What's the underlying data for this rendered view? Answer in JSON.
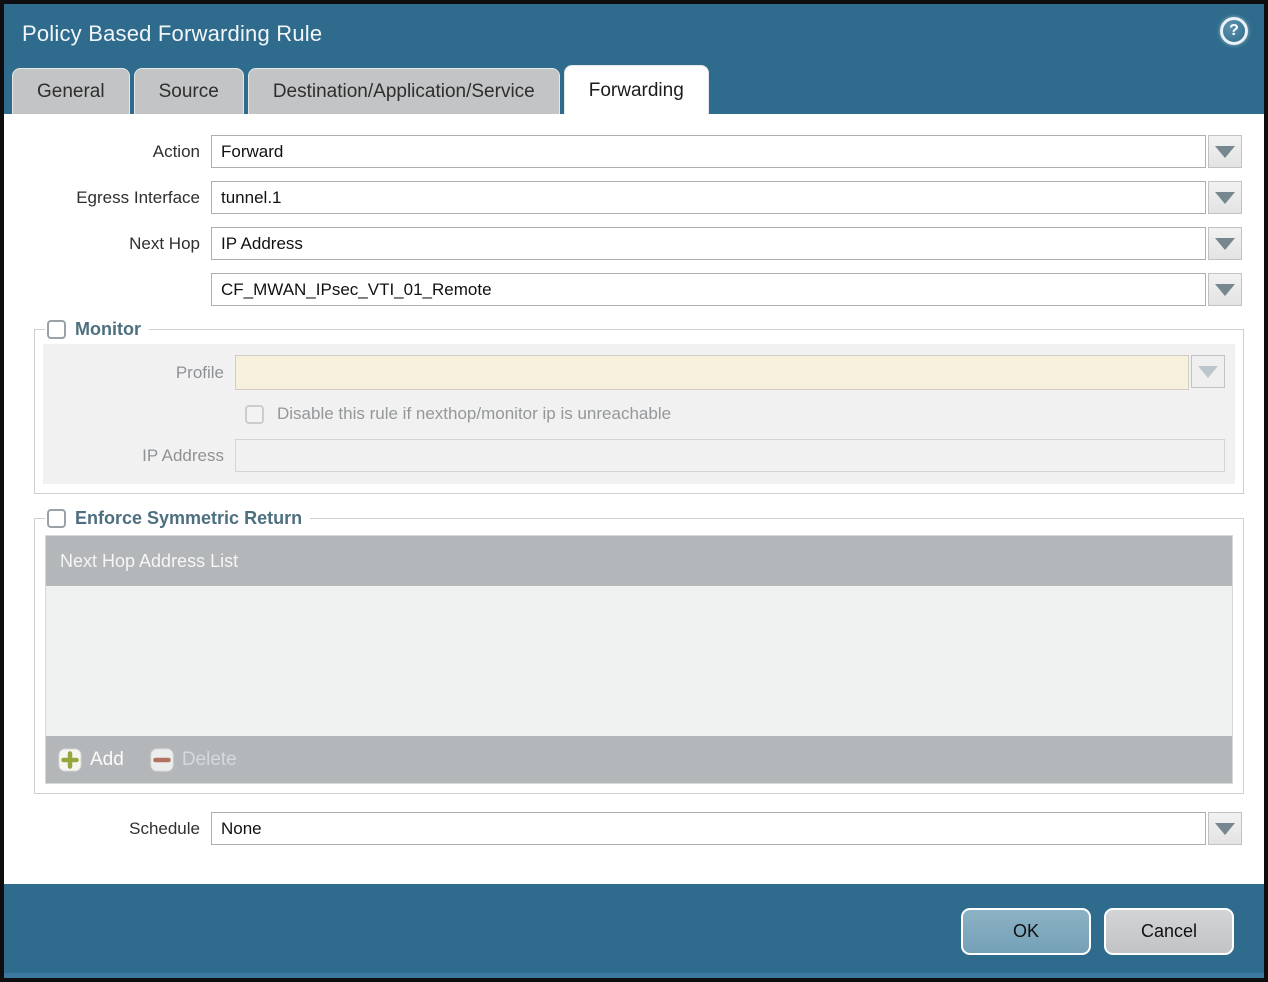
{
  "window": {
    "title": "Policy Based Forwarding Rule",
    "help_glyph": "?"
  },
  "tabs": [
    {
      "label": "General",
      "active": false
    },
    {
      "label": "Source",
      "active": false
    },
    {
      "label": "Destination/Application/Service",
      "active": false
    },
    {
      "label": "Forwarding",
      "active": true
    }
  ],
  "form": {
    "action": {
      "label": "Action",
      "value": "Forward"
    },
    "egress_interface": {
      "label": "Egress Interface",
      "value": "tunnel.1"
    },
    "next_hop": {
      "label": "Next Hop",
      "value": "IP Address"
    },
    "next_hop_address": {
      "value": "CF_MWAN_IPsec_VTI_01_Remote"
    },
    "schedule": {
      "label": "Schedule",
      "value": "None"
    }
  },
  "monitor": {
    "title": "Monitor",
    "checked": false,
    "profile": {
      "label": "Profile",
      "value": ""
    },
    "disable_rule_label": "Disable this rule if nexthop/monitor ip is unreachable",
    "disable_rule_checked": false,
    "ip_address": {
      "label": "IP Address",
      "value": ""
    }
  },
  "enforce_symmetric_return": {
    "title": "Enforce Symmetric Return",
    "checked": false,
    "table": {
      "header": "Next Hop Address List",
      "rows": []
    },
    "add_label": "Add",
    "delete_label": "Delete",
    "delete_enabled": false
  },
  "footer": {
    "ok_label": "OK",
    "cancel_label": "Cancel"
  },
  "colors": {
    "teal_background": "#2e6b8c",
    "active_tab": "#ffffff",
    "inactive_tab": "#c3c4c5",
    "legend_text": "#4e6f80",
    "disabled_field_beige": "#f6f0dd",
    "table_gray": "#b3b7ba",
    "ok_button": "#7da8bd",
    "cancel_button": "#c9cacd",
    "add_plus_green": "#94a83b",
    "delete_minus_red": "#b07262"
  }
}
